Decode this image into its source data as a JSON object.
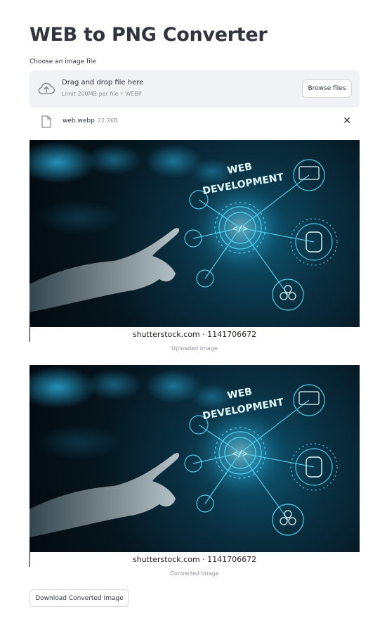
{
  "page": {
    "title": "WEB to PNG Converter"
  },
  "uploader": {
    "label": "Choose an image file",
    "drop_title": "Drag and drop file here",
    "drop_subtitle": "Limit 200MB per file • WEBP",
    "browse_label": "Browse files",
    "upload_icon": "cloud-upload-icon"
  },
  "file": {
    "name": "web.webp",
    "size": "22.2KB",
    "file_icon": "file-icon",
    "close_icon": "close-icon",
    "close_glyph": "✕"
  },
  "uploaded_image": {
    "heading_top": "WEB",
    "heading_bottom": "DEVELOPMENT",
    "watermark": "shutterstock.com · 1141706672",
    "caption": "Uploaded Image"
  },
  "converted_image": {
    "heading_top": "WEB",
    "heading_bottom": "DEVELOPMENT",
    "watermark": "shutterstock.com · 1141706672",
    "caption": "Converted Image"
  },
  "download": {
    "label": "Download Converted Image"
  },
  "colors": {
    "accent_glow": "#5ad6f5",
    "background_secondary": "#f0f2f6",
    "text": "#31333f",
    "muted": "#8e9099"
  }
}
